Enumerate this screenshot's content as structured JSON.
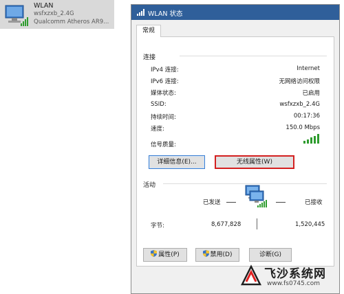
{
  "adapter": {
    "name": "WLAN",
    "ssid": "wsfxzxb_2.4G",
    "device": "Qualcomm Atheros AR9..."
  },
  "dialog": {
    "title": "WLAN 状态",
    "tab": "常规",
    "connection": {
      "title": "连接",
      "rows": [
        {
          "label": "IPv4 连接:",
          "value": "Internet"
        },
        {
          "label": "IPv6 连接:",
          "value": "无网络访问权限"
        },
        {
          "label": "媒体状态:",
          "value": "已启用"
        },
        {
          "label": "SSID:",
          "value": "wsfxzxb_2.4G"
        },
        {
          "label": "持续时间:",
          "value": "00:17:36"
        },
        {
          "label": "速度:",
          "value": "150.0 Mbps"
        }
      ],
      "signal_label": "信号质量:",
      "signal_level": 5,
      "signal_max": 5,
      "details_button": "详细信息(E)...",
      "wireless_props_button": "无线属性(W)"
    },
    "activity": {
      "title": "活动",
      "sent_label": "已发送",
      "received_label": "已接收",
      "bytes_label": "字节:",
      "bytes_sent": "8,677,828",
      "bytes_received": "1,520,445"
    },
    "buttons": {
      "properties": "属性(P)",
      "disable": "禁用(D)",
      "diagnose": "诊断(G)"
    }
  },
  "watermark": {
    "title": "飞沙系统网",
    "url": "www.fs0745.com"
  },
  "colors": {
    "titlebar": "#2f5f9a",
    "highlight_box": "#d31f1f",
    "signal_green": "#2e9c2e"
  }
}
